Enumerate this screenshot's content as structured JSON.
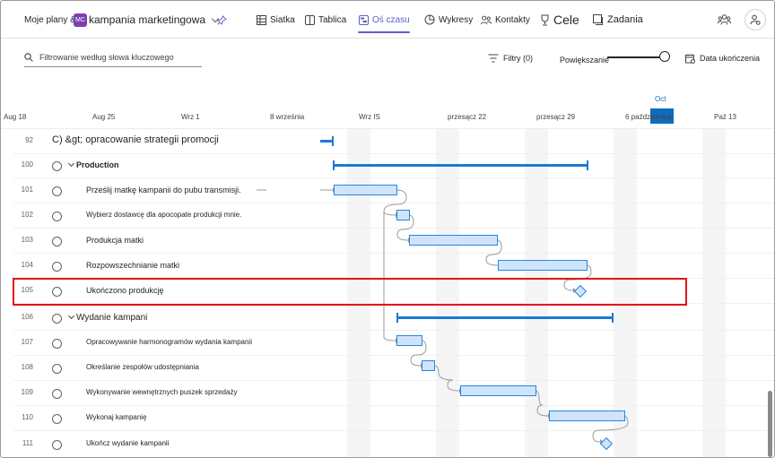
{
  "topbar": {
    "breadcrumb": "Moje plany &gt;",
    "plan_badge": "MC",
    "plan_name": "kampania marketingowa",
    "tabs": [
      {
        "label": "Siatka",
        "icon": "grid-icon"
      },
      {
        "label": "Tablica",
        "icon": "board-icon"
      },
      {
        "label": "Oś czasu",
        "icon": "timeline-icon",
        "active": true
      },
      {
        "label": "Wykresy",
        "icon": "charts-icon"
      },
      {
        "label": "Kontakty",
        "icon": "people-icon"
      },
      {
        "label": "Cele",
        "icon": "goal-icon"
      },
      {
        "label": "Zadania",
        "icon": "tasks-icon"
      }
    ]
  },
  "toolbar": {
    "search_placeholder": "Filtrowanie według słowa kluczowego",
    "filters_label": "Filtry (0)",
    "zoom_label": "Powiększanie",
    "zoom_level": 1.0,
    "finish_date_label": "Data ukończenia"
  },
  "timeline": {
    "month_label": "Oct",
    "today_day": "5",
    "dates": [
      "Aug 18",
      "Aug 25",
      "Wrz 1",
      "8 września",
      "Wrz IS",
      "przesącz 22",
      "przesącz 29",
      "6 października",
      "Paź 13"
    ]
  },
  "rows": [
    {
      "num": "92",
      "title": "C) &gt; opracowanie strategii promocji"
    },
    {
      "num": "100",
      "title": "Production"
    },
    {
      "num": "101",
      "title": "Prześlij matkę kampanii do pubu transmisji."
    },
    {
      "num": "102",
      "title": "Wybierz dostawcę dla apocopate produkcji mnie."
    },
    {
      "num": "103",
      "title": "Produkcja matki"
    },
    {
      "num": "104",
      "title": "Rozpowszechnianie matki"
    },
    {
      "num": "105",
      "title": "Ukończono produkcję"
    },
    {
      "num": "106",
      "title": "Wydanie kampani"
    },
    {
      "num": "107",
      "title": "Opracowywanie harmonogramów wydania kampanii"
    },
    {
      "num": "108",
      "title": "Określanie zespołów udostępniania"
    },
    {
      "num": "109",
      "title": "Wykonywanie wewnętrznych puszek sprzedaży"
    },
    {
      "num": "110",
      "title": "Wykonaj kampanię"
    },
    {
      "num": "111",
      "title": "Ukończ wydanie kampanii"
    }
  ],
  "colors": {
    "accent": "#5b5fc7",
    "bar_fill": "#cfe4fa",
    "bar_border": "#2886de",
    "summary": "#1b7ad3",
    "highlight": "#e3121b"
  }
}
